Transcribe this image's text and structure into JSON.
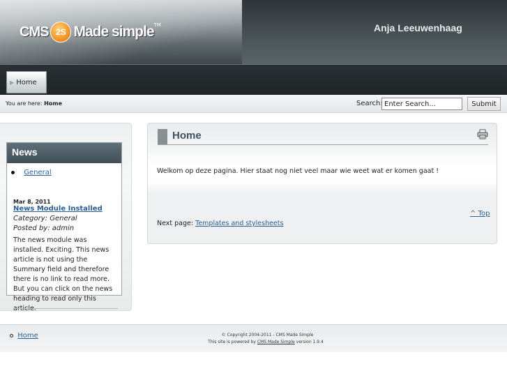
{
  "header": {
    "logo_cms": "CMS",
    "logo_badge": "2S",
    "logo_made_simple": "Made simple",
    "logo_tm": "TM",
    "site_name": "Anja Leeuwenhaag"
  },
  "menu": {
    "home_label": "Home"
  },
  "breadcrumb": {
    "prefix": "You are here:",
    "current": "Home"
  },
  "search": {
    "label": "Search:",
    "value": "Enter Search...",
    "button_label": "Submit"
  },
  "sidebar": {
    "news_title": "News",
    "category_link": "General",
    "article": {
      "date": "Mar 8, 2011",
      "title": "News Module Installed",
      "category": "Category: General",
      "posted_by": "Posted by: admin",
      "body": "The news module was installed. Exciting. This news article is not using the Summary field and therefore there is no link to read more. But you can click on the news heading to read only this article."
    }
  },
  "content": {
    "title": "Home",
    "body": "Welkom op deze pagina. Hier staat nog niet veel maar wie weet wat er komen gaat !",
    "top_link": "^ Top",
    "next_page_label": "Next page:",
    "next_page_link": "Templates and stylesheets"
  },
  "footer": {
    "home_link": "Home",
    "copyright": "© Copyright 2004-2011 - CMS Made Simple",
    "powered_prefix": "This site is powered by",
    "powered_link": "CMS Made Simple",
    "powered_suffix": "version 1.9.4"
  },
  "icons": {
    "print": "printer-icon",
    "menu_arrow": "arrow-right-icon"
  }
}
